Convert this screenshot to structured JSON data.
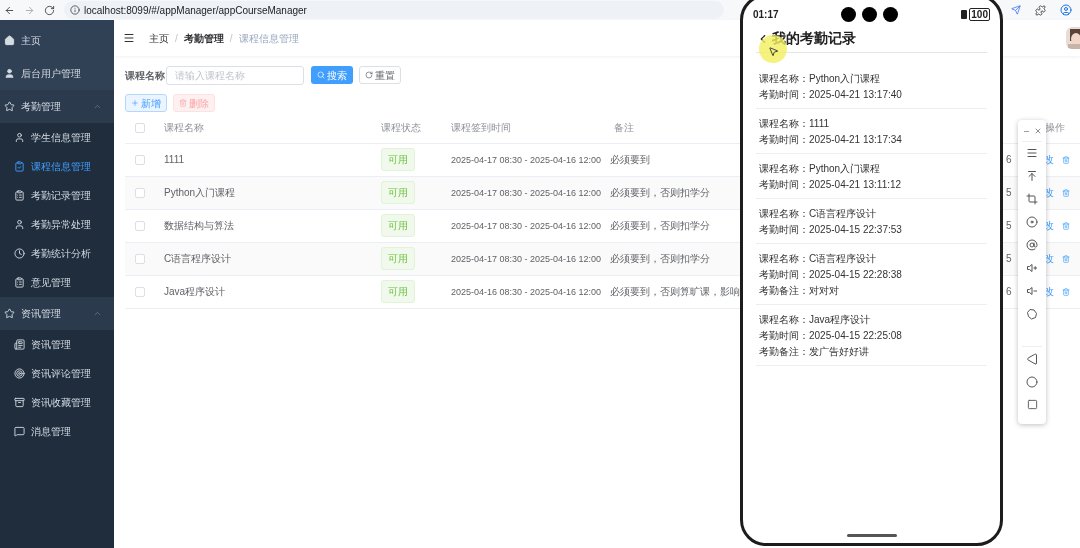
{
  "browser": {
    "url": "localhost:8099/#/appManager/appCourseManager"
  },
  "sidebar": {
    "items": [
      {
        "label": "主页",
        "selected": false
      },
      {
        "label": "后台用户管理",
        "selected": false
      },
      {
        "label": "考勤管理",
        "expanded": true,
        "children": [
          {
            "label": "学生信息管理",
            "selected": false
          },
          {
            "label": "课程信息管理",
            "selected": true
          },
          {
            "label": "考勤记录管理",
            "selected": false
          },
          {
            "label": "考勤异常处理",
            "selected": false
          },
          {
            "label": "考勤统计分析",
            "selected": false
          },
          {
            "label": "意见管理",
            "selected": false
          }
        ]
      },
      {
        "label": "资讯管理",
        "expanded": true,
        "children": [
          {
            "label": "资讯管理",
            "selected": false
          },
          {
            "label": "资讯评论管理",
            "selected": false
          },
          {
            "label": "资讯收藏管理",
            "selected": false
          },
          {
            "label": "消息管理",
            "selected": false
          }
        ]
      }
    ]
  },
  "breadcrumb": {
    "items": [
      "主页",
      "考勤管理",
      "课程信息管理"
    ],
    "separator": "/"
  },
  "search": {
    "label": "课程名称",
    "placeholder": "请输入课程名称",
    "search_button": "搜索",
    "reset_button": "重置"
  },
  "actions": {
    "add": {
      "label": "新增",
      "disabled": false
    },
    "delete": {
      "label": "删除",
      "disabled": true
    }
  },
  "table": {
    "columns": [
      "课程名称",
      "课程状态",
      "课程签到时间",
      "备注",
      "操作"
    ],
    "rows": [
      {
        "checked": false,
        "name": "1111",
        "status": "可用",
        "time": "2025-04-17 08:30 - 2025-04-16 12:00",
        "note": "必须要到",
        "column_6": "6",
        "edit": "改"
      },
      {
        "checked": false,
        "name": "Python入门课程",
        "status": "可用",
        "time": "2025-04-17 08:30 - 2025-04-16 12:00",
        "note": "必须要到，否则扣学分",
        "column_6": "5",
        "edit": "改"
      },
      {
        "checked": false,
        "name": "数据结构与算法",
        "status": "可用",
        "time": "2025-04-17 08:30 - 2025-04-16 12:00",
        "note": "必须要到，否则扣学分",
        "column_6": "5",
        "edit": "改"
      },
      {
        "checked": false,
        "name": "C语言程序设计",
        "status": "可用",
        "time": "2025-04-17 08:30 - 2025-04-16 12:00",
        "note": "必须要到，否则扣学分",
        "column_6": "5",
        "edit": "改"
      },
      {
        "checked": false,
        "name": "Java程序设计",
        "status": "可用",
        "time": "2025-04-16 08:30 - 2025-04-16 12:00",
        "note": "必须要到，否则算旷课，影响",
        "column_6": "6",
        "edit": "改"
      }
    ]
  },
  "phone": {
    "time": "01:17",
    "battery": "100",
    "title": "我的考勤记录",
    "records": [
      {
        "fields": [
          {
            "label": "课程名称：",
            "value": "Python入门课程"
          },
          {
            "label": "考勤时间：",
            "value": "2025-04-21 13:17:40"
          }
        ]
      },
      {
        "fields": [
          {
            "label": "课程名称：",
            "value": "1111"
          },
          {
            "label": "考勤时间：",
            "value": "2025-04-21 13:17:34"
          }
        ]
      },
      {
        "fields": [
          {
            "label": "课程名称：",
            "value": "Python入门课程"
          },
          {
            "label": "考勤时间：",
            "value": "2025-04-21 13:11:12"
          }
        ]
      },
      {
        "fields": [
          {
            "label": "课程名称：",
            "value": "C语言程序设计"
          },
          {
            "label": "考勤时间：",
            "value": "2025-04-15 22:37:53"
          }
        ]
      },
      {
        "fields": [
          {
            "label": "课程名称：",
            "value": "C语言程序设计"
          },
          {
            "label": "考勤时间：",
            "value": "2025-04-15 22:28:38"
          },
          {
            "label": "考勤备注：",
            "value": "对对对"
          }
        ]
      },
      {
        "fields": [
          {
            "label": "课程名称：",
            "value": "Java程序设计"
          },
          {
            "label": "考勤时间：",
            "value": "2025-04-15 22:25:08"
          },
          {
            "label": "考勤备注：",
            "value": "发广告好好讲"
          }
        ]
      }
    ]
  }
}
